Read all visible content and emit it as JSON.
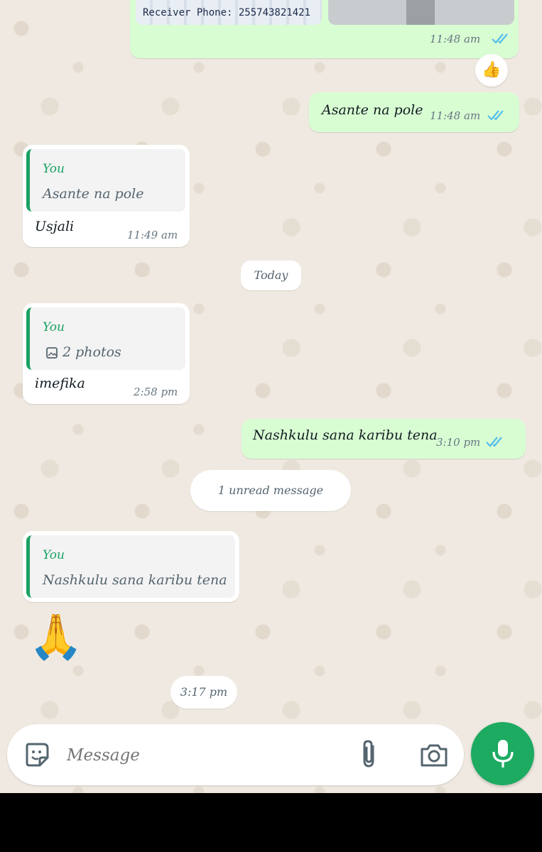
{
  "colors": {
    "outgoing": "#d9fdd3",
    "incoming": "#ffffff",
    "accent": "#1aa163",
    "ticks": "#53bdeb",
    "mic": "#1daa61"
  },
  "messages": {
    "m1": {
      "time": "11:48 am",
      "receipt_icon": "double-check-icon",
      "image_text": "Receiver Phone: 255743821421"
    },
    "m1_reaction": {
      "emoji": "👍"
    },
    "m2": {
      "text": "Asante na pole",
      "time": "11:48 am",
      "receipt_icon": "double-check-icon"
    },
    "m3": {
      "quote_author": "You",
      "quote_text": "Asante na pole",
      "text": "Usjali",
      "time": "11:49 am"
    },
    "m4": {
      "quote_author": "You",
      "quote_icon": "image-icon",
      "quote_text": "2 photos",
      "text": "imefika",
      "time": "2:58 pm"
    },
    "m5": {
      "text": "Nashkulu sana karibu tena",
      "time": "3:10 pm",
      "receipt_icon": "double-check-icon"
    },
    "m6": {
      "quote_author": "You",
      "quote_text": "Nashkulu sana karibu tena",
      "emoji": "🙏",
      "time": "3:17 pm"
    }
  },
  "dividers": {
    "today": "Today",
    "unread": "1 unread message"
  },
  "composer": {
    "placeholder": "Message",
    "sticker_icon": "sticker-icon",
    "attach_icon": "paperclip-icon",
    "camera_icon": "camera-icon",
    "mic_icon": "microphone-icon"
  }
}
